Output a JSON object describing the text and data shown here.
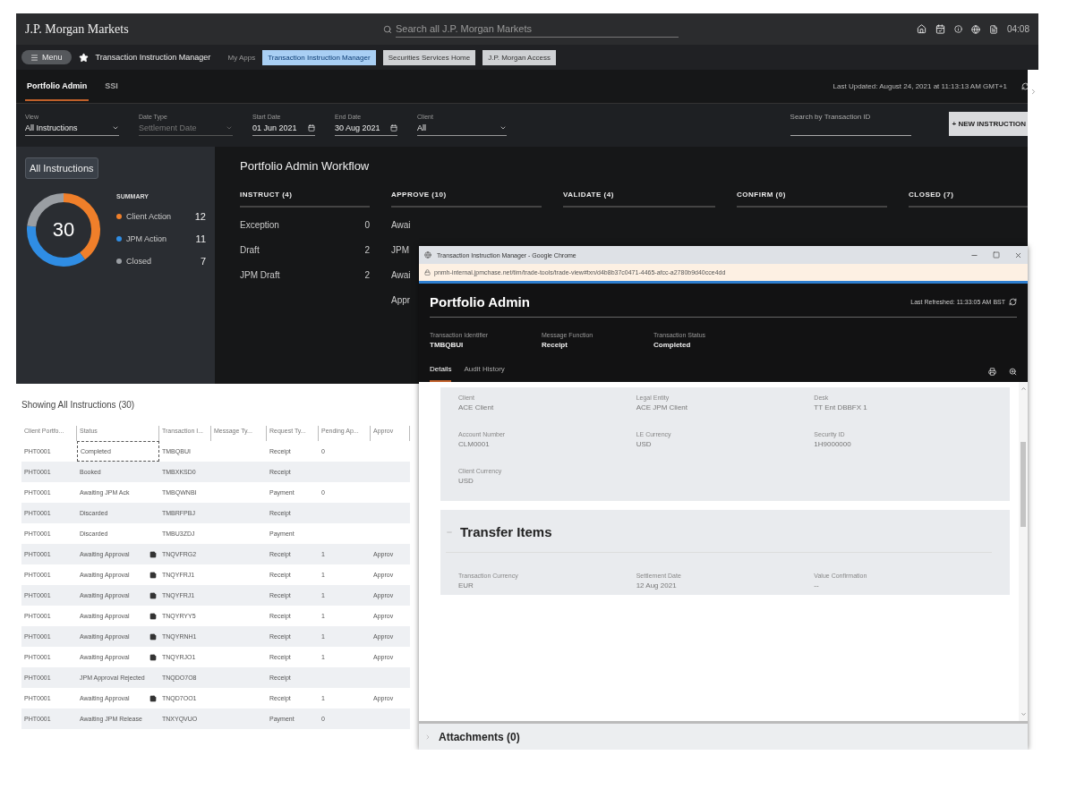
{
  "header": {
    "logo": "J.P. Morgan Markets",
    "search": {
      "placeholder": "Search all J.P. Morgan Markets"
    },
    "time": "04:08"
  },
  "nav": {
    "menu": "Menu",
    "app_title": "Transaction Instruction Manager",
    "my_apps": "My Apps",
    "apps": [
      {
        "label": "Transaction Instruction Manager",
        "selected": true
      },
      {
        "label": "Securities Services Home",
        "selected": false
      },
      {
        "label": "J.P. Morgan Access",
        "selected": false
      }
    ]
  },
  "tabs": [
    {
      "label": "Portfolio Admin",
      "selected": true
    },
    {
      "label": "SSI",
      "selected": false
    }
  ],
  "last_updated": "Last Updated: August 24, 2021 at 11:13:13 AM GMT+1",
  "filters": [
    {
      "label": "View",
      "value": "All Instructions",
      "kind": "select",
      "disabled": false
    },
    {
      "label": "Date Type",
      "value": "Settlement Date",
      "kind": "select",
      "disabled": true
    },
    {
      "label": "Start Date",
      "value": "01 Jun 2021",
      "kind": "date",
      "disabled": false
    },
    {
      "label": "End Date",
      "value": "30 Aug 2021",
      "kind": "date",
      "disabled": false
    },
    {
      "label": "Client",
      "value": "All",
      "kind": "select",
      "disabled": false
    }
  ],
  "search_transaction": {
    "placeholder": "Search by Transaction ID"
  },
  "new_button": "+ NEW INSTRUCTION",
  "summary": {
    "filter": "All Instructions",
    "total": "30",
    "heading": "SUMMARY",
    "items": [
      {
        "label": "Client Action",
        "count": "12",
        "color": "#f07f2a"
      },
      {
        "label": "JPM Action",
        "count": "11",
        "color": "#2f8de4"
      },
      {
        "label": "Closed",
        "count": "7",
        "color": "#9a9ea3"
      }
    ]
  },
  "workflow": {
    "title": "Portfolio Admin Workflow",
    "stages": [
      {
        "title": "INSTRUCT (4)",
        "items": [
          {
            "label": "Exception",
            "count": "0"
          },
          {
            "label": "Draft",
            "count": "2"
          },
          {
            "label": "JPM Draft",
            "count": "2"
          }
        ]
      },
      {
        "title": "APPROVE (10)",
        "items": [
          {
            "label": "Awai"
          },
          {
            "label": "JPM"
          },
          {
            "label": "Awai"
          },
          {
            "label": "Appr"
          }
        ]
      },
      {
        "title": "VALIDATE (4)"
      },
      {
        "title": "CONFIRM (0)"
      },
      {
        "title": "CLOSED (7)"
      }
    ]
  },
  "table": {
    "caption": "Showing All Instructions (30)",
    "columns": [
      "Client Portfo...",
      "Status",
      "Transaction I...",
      "Message Ty...",
      "Request Ty...",
      "Pending Ap...",
      "Approv"
    ],
    "rows": [
      {
        "selected": true,
        "flagged": false,
        "cells": [
          "PHT0001",
          "Completed",
          "TMBQBUI",
          "",
          "Receipt",
          "0",
          ""
        ]
      },
      {
        "selected": false,
        "flagged": false,
        "cells": [
          "PHT0001",
          "Booked",
          "TMBXKSD0",
          "",
          "Receipt",
          "",
          ""
        ]
      },
      {
        "selected": false,
        "flagged": false,
        "cells": [
          "PHT0001",
          "Awaiting JPM Ack",
          "TMBQWNBI",
          "",
          "Payment",
          "0",
          ""
        ]
      },
      {
        "selected": false,
        "flagged": false,
        "cells": [
          "PHT0001",
          "Discarded",
          "TMBRFPBJ",
          "",
          "Receipt",
          "",
          ""
        ]
      },
      {
        "selected": false,
        "flagged": false,
        "cells": [
          "PHT0001",
          "Discarded",
          "TMBU3ZDJ",
          "",
          "Payment",
          "",
          ""
        ]
      },
      {
        "selected": false,
        "flagged": true,
        "cells": [
          "PHT0001",
          "Awaiting Approval",
          "TNQVFRG2",
          "",
          "Receipt",
          "1",
          "Approv"
        ]
      },
      {
        "selected": false,
        "flagged": true,
        "cells": [
          "PHT0001",
          "Awaiting Approval",
          "TNQYFRJ1",
          "",
          "Receipt",
          "1",
          "Approv"
        ]
      },
      {
        "selected": false,
        "flagged": true,
        "cells": [
          "PHT0001",
          "Awaiting Approval",
          "TNQYFRJ1",
          "",
          "Receipt",
          "1",
          "Approv"
        ]
      },
      {
        "selected": false,
        "flagged": true,
        "cells": [
          "PHT0001",
          "Awaiting Approval",
          "TNQYRYY5",
          "",
          "Receipt",
          "1",
          "Approv"
        ]
      },
      {
        "selected": false,
        "flagged": true,
        "cells": [
          "PHT0001",
          "Awaiting Approval",
          "TNQYRNH1",
          "",
          "Receipt",
          "1",
          "Approv"
        ]
      },
      {
        "selected": false,
        "flagged": true,
        "cells": [
          "PHT0001",
          "Awaiting Approval",
          "TNQYRJO1",
          "",
          "Receipt",
          "1",
          "Approv"
        ]
      },
      {
        "selected": false,
        "flagged": false,
        "cells": [
          "PHT0001",
          "JPM Approval Rejected",
          "TNQDO7O8",
          "",
          "Receipt",
          "",
          ""
        ]
      },
      {
        "selected": false,
        "flagged": true,
        "cells": [
          "PHT0001",
          "Awaiting Approval",
          "TNQD7OO1",
          "",
          "Receipt",
          "1",
          "Approv"
        ]
      },
      {
        "selected": false,
        "flagged": false,
        "cells": [
          "PHT0001",
          "Awaiting JPM Release",
          "TNXYQVUO",
          "",
          "Payment",
          "0",
          ""
        ]
      }
    ]
  },
  "popup": {
    "window_title": "Transaction Instruction Manager - Google Chrome",
    "url": "pnmh-internal.jpmchase.net/tim/trade-tools/trade-view#txn/d4b8b37c0471-4465-afcc-a2780b9d40cce4dd",
    "title": "Portfolio Admin",
    "last_refreshed": "Last Refreshed: 11:33:05 AM BST",
    "fields": [
      {
        "label": "Transaction Identifier",
        "value": "TMBQBUI"
      },
      {
        "label": "Message Function",
        "value": "Receipt"
      },
      {
        "label": "Transaction Status",
        "value": "Completed"
      }
    ],
    "tabs": [
      {
        "label": "Details",
        "selected": true
      },
      {
        "label": "Audit History",
        "selected": false
      }
    ],
    "details": [
      {
        "label": "Client",
        "value": "ACE Client"
      },
      {
        "label": "Legal Entity",
        "value": "ACE JPM Client"
      },
      {
        "label": "Desk",
        "value": "TT Ent DBBFX 1"
      },
      {
        "label": "Account Number",
        "value": "CLM0001"
      },
      {
        "label": "LE Currency",
        "value": "USD"
      },
      {
        "label": "Security ID",
        "value": "1H9000000"
      },
      {
        "label": "Client Currency",
        "value": "USD"
      }
    ],
    "transfer": {
      "title": "Transfer Items",
      "expanded": true,
      "fields": [
        {
          "label": "Transaction Currency",
          "value": "EUR"
        },
        {
          "label": "Settlement Date",
          "value": "12 Aug 2021"
        },
        {
          "label": "Value Confirmation",
          "value": "--"
        }
      ]
    },
    "attachments": "Attachments (0)"
  }
}
